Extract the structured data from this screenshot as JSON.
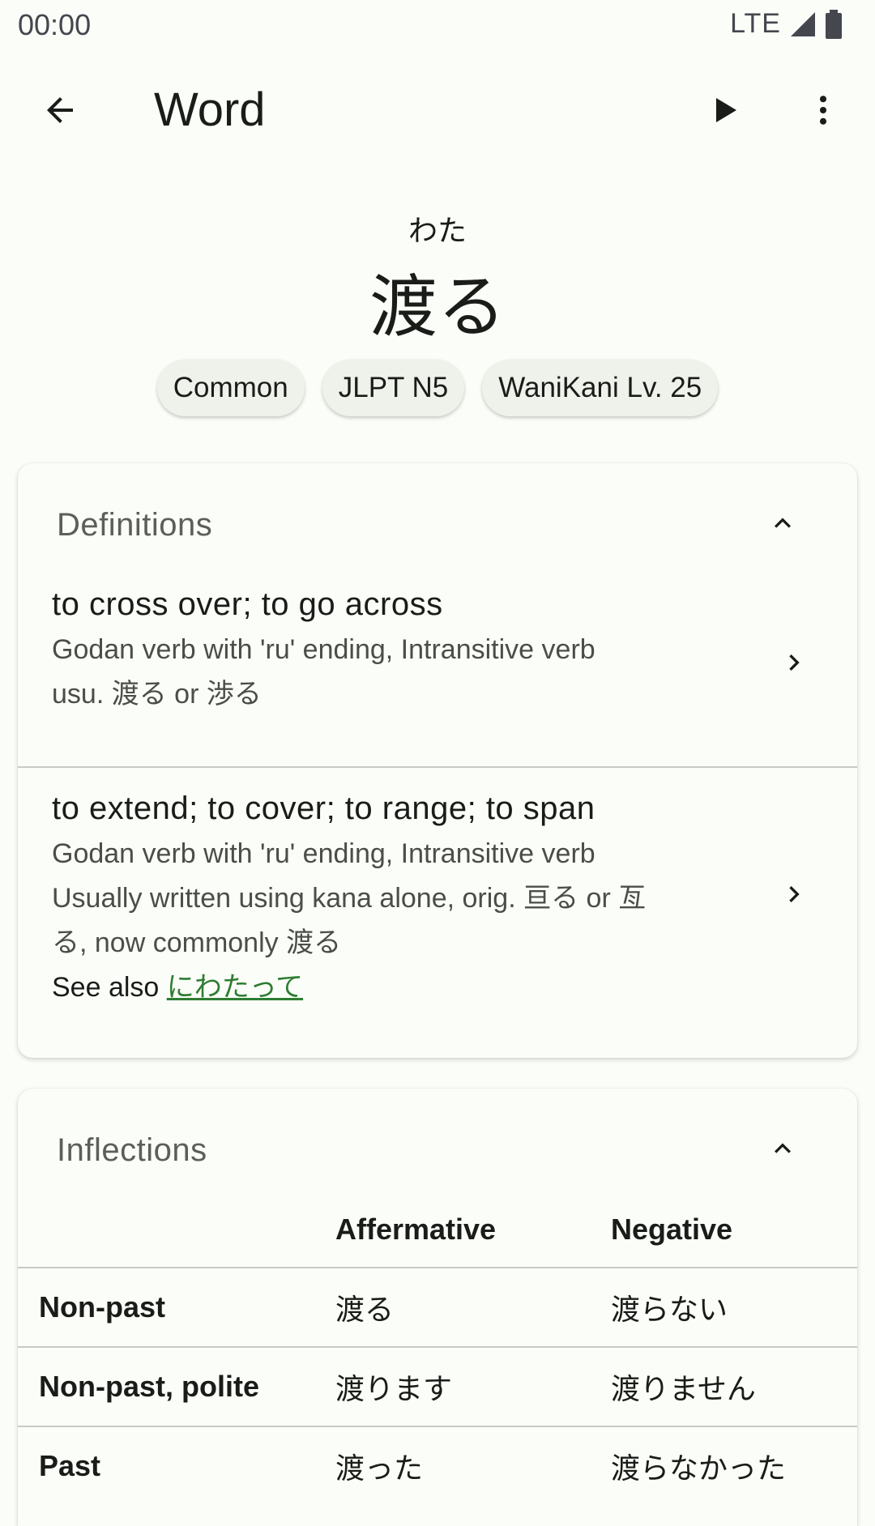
{
  "status_bar": {
    "time": "00:00",
    "network": "LTE"
  },
  "app_bar": {
    "title": "Word"
  },
  "word": {
    "reading": "わた",
    "kanji": "渡る"
  },
  "tags": [
    "Common",
    "JLPT N5",
    "WaniKani Lv. 25"
  ],
  "definitions": {
    "title": "Definitions",
    "items": [
      {
        "gloss": "to cross over; to go across",
        "pos": "Godan verb with 'ru' ending, Intransitive verb",
        "note_lines": [
          "usu. 渡る or 渉る"
        ]
      },
      {
        "gloss": "to extend; to cover; to range; to span",
        "pos": "Godan verb with 'ru' ending, Intransitive verb",
        "note_lines": [
          "Usually written using kana alone, orig. 亘る or 亙",
          "る, now commonly 渡る"
        ],
        "see_also_label": "See also",
        "see_also_link": "にわたって"
      }
    ]
  },
  "inflections": {
    "title": "Inflections",
    "columns": [
      "Affermative",
      "Negative"
    ],
    "rows": [
      {
        "label": "Non-past",
        "affirmative": "渡る",
        "negative": "渡らない"
      },
      {
        "label": "Non-past, polite",
        "affirmative": "渡ります",
        "negative": "渡りません"
      },
      {
        "label": "Past",
        "affirmative": "渡った",
        "negative": "渡らなかった"
      }
    ]
  }
}
